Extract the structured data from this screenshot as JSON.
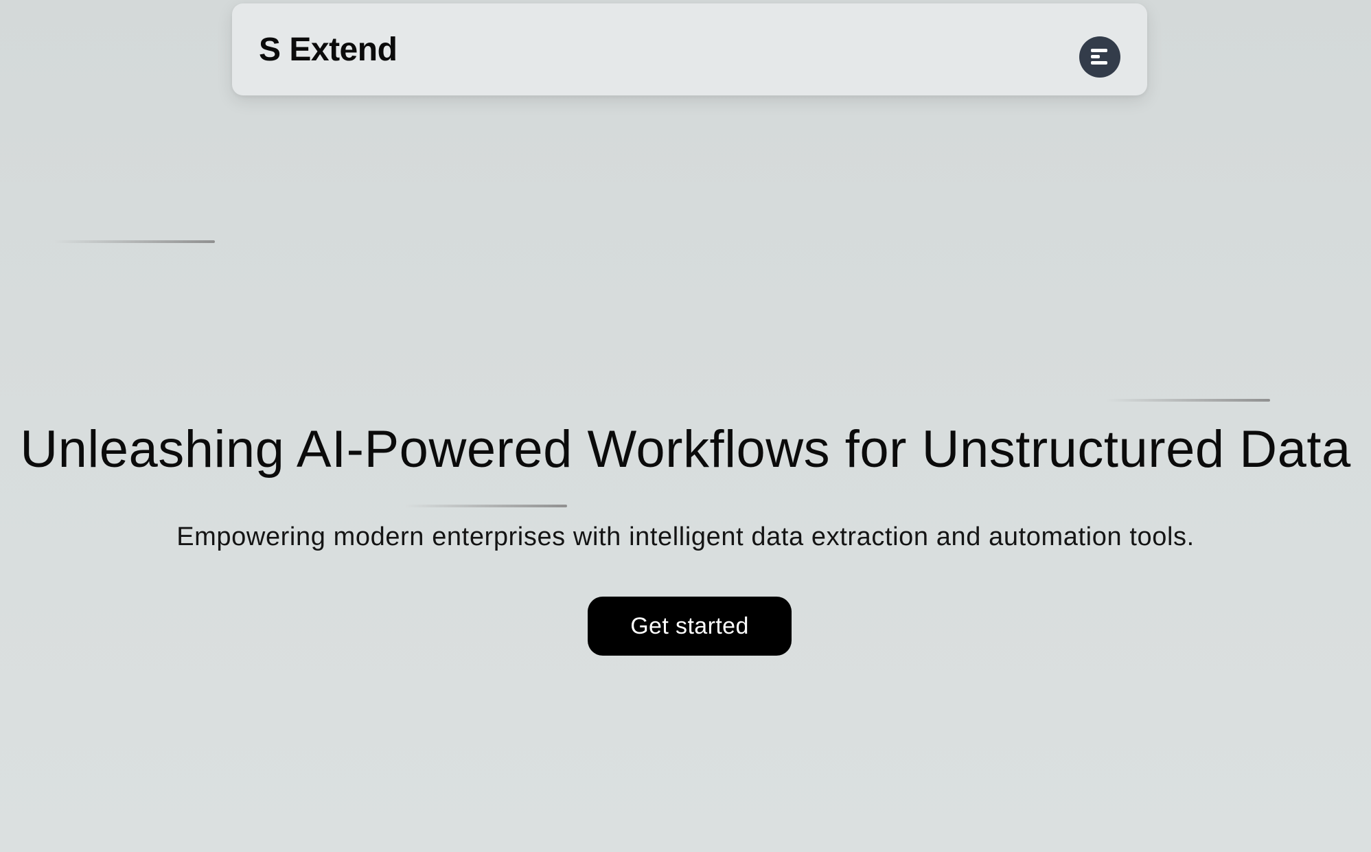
{
  "navbar": {
    "brand": "S Extend",
    "menu_icon": "menu-icon"
  },
  "hero": {
    "title": "Unleashing AI-Powered Workflows for Unstructured Data",
    "subtitle": "Empowering modern enterprises with intelligent data extraction and automation tools.",
    "cta_label": "Get started"
  },
  "colors": {
    "background": "#d8dddd",
    "navbar_bg": "#e5e8e9",
    "menu_button_bg": "#333c4a",
    "cta_bg": "#000000",
    "cta_text": "#ffffff",
    "text": "#0b0b0b"
  }
}
